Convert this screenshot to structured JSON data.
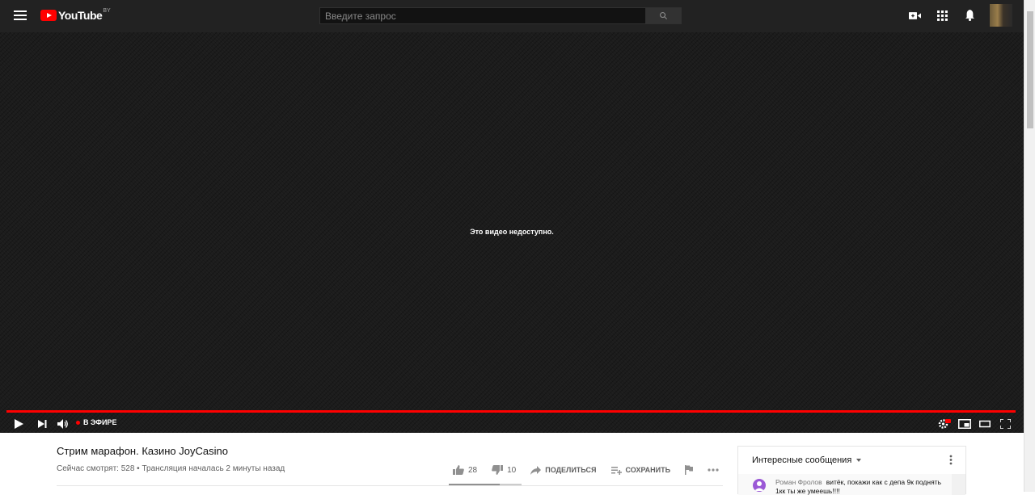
{
  "header": {
    "logo_text": "YouTube",
    "logo_country": "BY",
    "search_placeholder": "Введите запрос"
  },
  "player": {
    "message": "Это видео недоступно.",
    "live_label": "В ЭФИРЕ",
    "progress": 1.0,
    "accent_color": "#ff0000"
  },
  "video": {
    "title": "Стрим марафон. Казино JoyCasino",
    "meta": "Сейчас смотрят: 528 • Трансляция началась 2 минуты назад",
    "likes": "28",
    "dislikes": "10",
    "share_label": "ПОДЕЛИТЬСЯ",
    "save_label": "СОХРАНИТЬ"
  },
  "chat": {
    "title": "Интересные сообщения",
    "message": {
      "author": "Роман Фролов",
      "text": "витёк, покажи как с депа 9к поднять 1кк ты же умеешь!!!!"
    }
  },
  "icons": {
    "menu": "hamburger-icon",
    "search": "search-icon",
    "upload": "video-camera-icon",
    "apps": "apps-grid-icon",
    "notifications": "bell-icon"
  }
}
